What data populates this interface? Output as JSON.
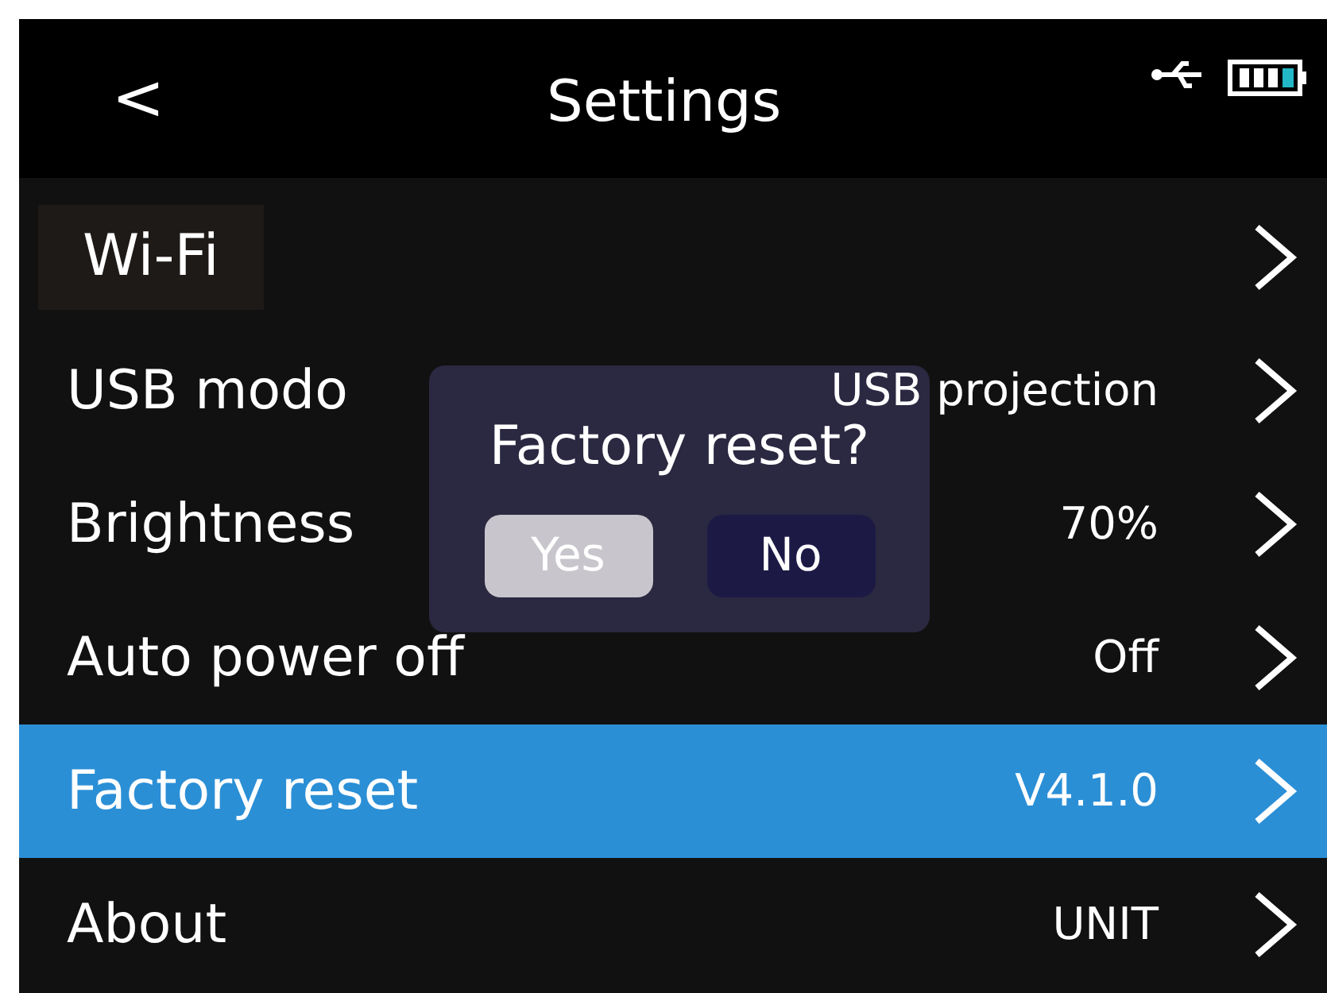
{
  "header": {
    "back": "<",
    "title": "Settings"
  },
  "rows": [
    {
      "label": "Wi-Fi",
      "value": "",
      "selected": false
    },
    {
      "label": "USB modo",
      "value": "USB projection",
      "selected": false
    },
    {
      "label": "Brightness",
      "value": "70%",
      "selected": false
    },
    {
      "label": "Auto power off",
      "value": "Off",
      "selected": false
    },
    {
      "label": "Factory reset",
      "value": "V4.1.0",
      "selected": true
    },
    {
      "label": "About",
      "value": "UNIT",
      "selected": false
    }
  ],
  "dialog": {
    "title": "Factory reset?",
    "buttons": [
      {
        "label": "Yes",
        "selected": true
      },
      {
        "label": "No",
        "selected": false
      }
    ]
  }
}
